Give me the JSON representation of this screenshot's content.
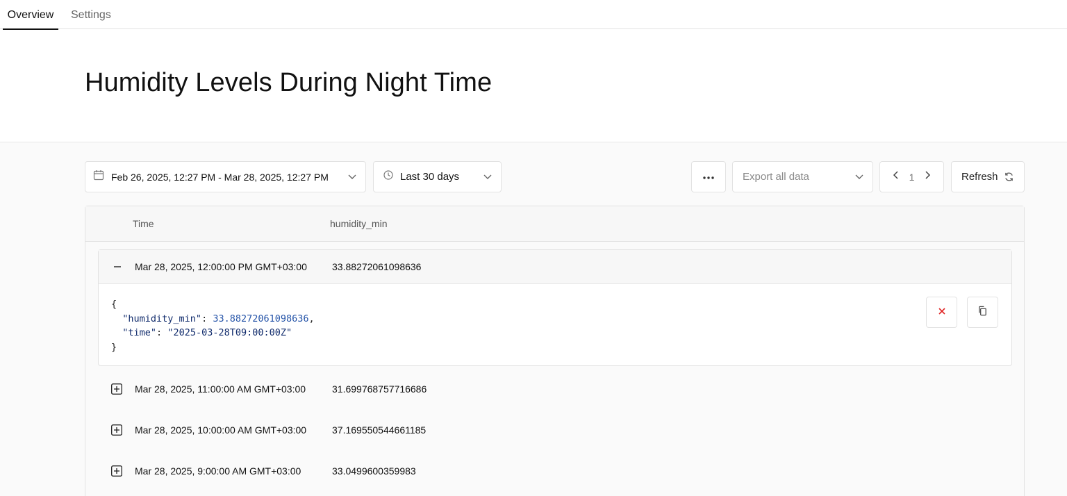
{
  "tabs": [
    {
      "label": "Overview",
      "active": true
    },
    {
      "label": "Settings",
      "active": false
    }
  ],
  "page_title": "Humidity Levels During Night Time",
  "toolbar": {
    "date_range": "Feb 26, 2025, 12:27 PM - Mar 28, 2025, 12:27 PM",
    "preset": "Last 30 days",
    "export_placeholder": "Export all data",
    "page_number": "1",
    "refresh_label": "Refresh"
  },
  "table": {
    "columns": [
      "Time",
      "humidity_min"
    ],
    "expanded_row": {
      "time": "Mar 28, 2025, 12:00:00 PM GMT+03:00",
      "value": "33.88272061098636",
      "json": {
        "open": "{",
        "key1": "\"humidity_min\"",
        "val1": "33.88272061098636",
        "key2": "\"time\"",
        "val2": "\"2025-03-28T09:00:00Z\"",
        "close": "}"
      }
    },
    "rows": [
      {
        "time": "Mar 28, 2025, 11:00:00 AM GMT+03:00",
        "value": "31.699768757716686"
      },
      {
        "time": "Mar 28, 2025, 10:00:00 AM GMT+03:00",
        "value": "37.169550544661185"
      },
      {
        "time": "Mar 28, 2025, 9:00:00 AM GMT+03:00",
        "value": "33.0499600359983"
      }
    ]
  },
  "colors": {
    "accent": "#111111",
    "close_icon": "#e02424",
    "json_key": "#0f2a6b",
    "json_number": "#2453a8"
  }
}
